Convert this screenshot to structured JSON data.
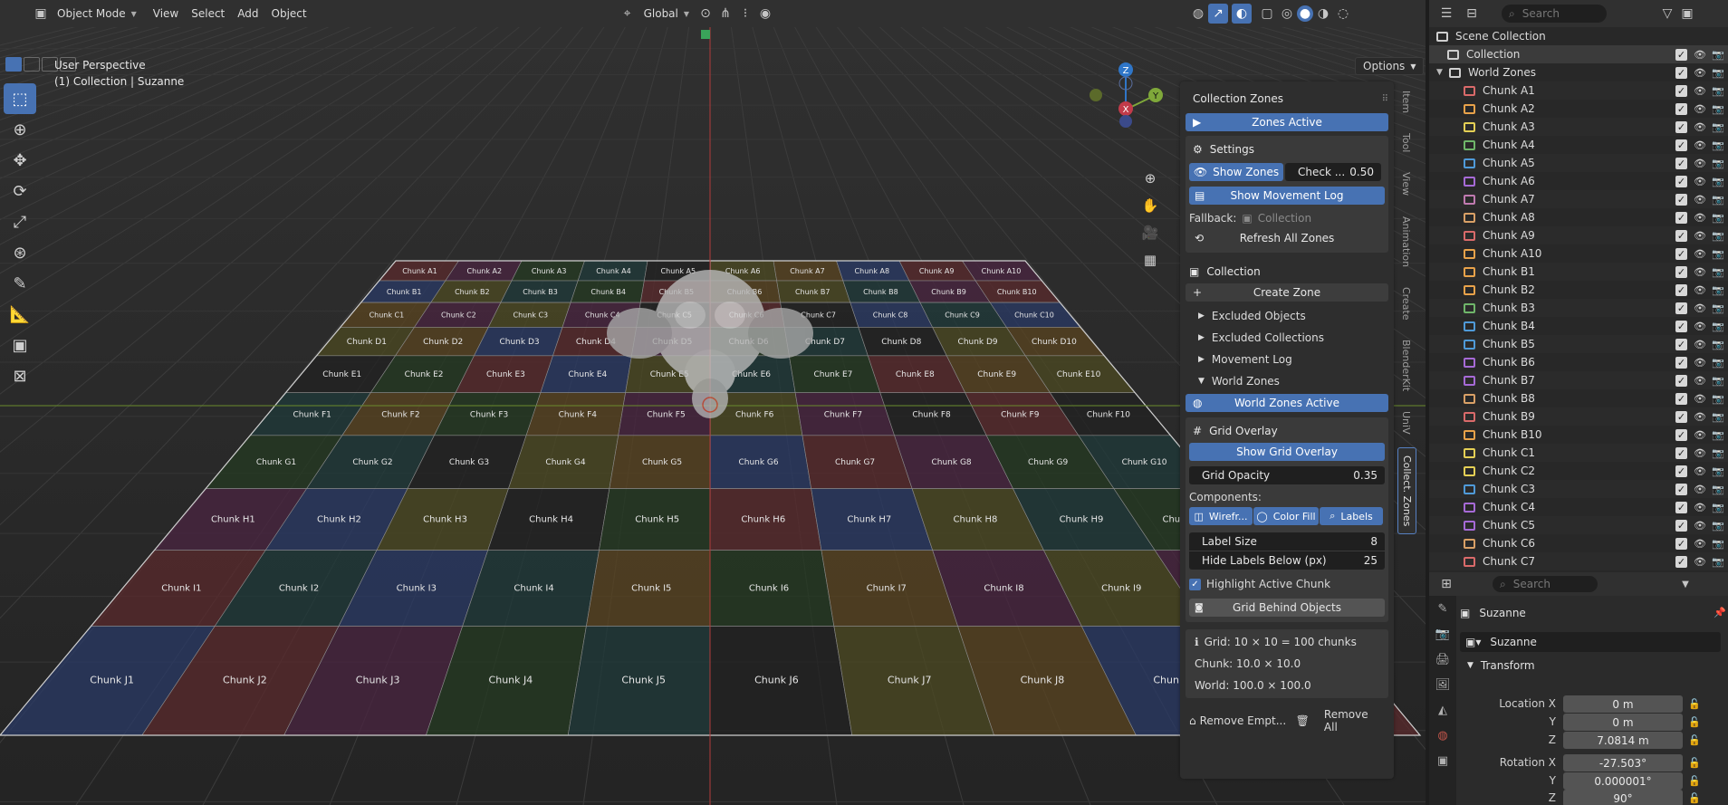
{
  "header": {
    "mode": "Object Mode",
    "menus": [
      "View",
      "Select",
      "Add",
      "Object"
    ],
    "orientation": "Global",
    "options_label": "Options"
  },
  "viewport": {
    "perspective": "User Perspective",
    "context": "(1) Collection | Suzanne",
    "gizmo": {
      "z": "Z",
      "x": "X",
      "y": "Y"
    }
  },
  "grid": {
    "rows": [
      "A",
      "B",
      "C",
      "D",
      "E",
      "F",
      "G",
      "H",
      "I",
      "J"
    ],
    "cols": 10,
    "prefix": "Chunk "
  },
  "colors": {
    "accent": "#4772b3",
    "chunk_palette": [
      "#5a2a2c",
      "#4c4a22",
      "#243a22",
      "#2a3a66",
      "#222222",
      "#4a2440",
      "#5a4420",
      "#1f3a3a"
    ]
  },
  "sidetabs": [
    "Item",
    "Tool",
    "View",
    "Animation",
    "Create",
    "BlenderKit",
    "UniV",
    "Collect. Zones"
  ],
  "panel": {
    "title": "Collection Zones",
    "zones_active": "Zones Active",
    "settings": "Settings",
    "show_zones": "Show Zones",
    "check_label": "Check ...",
    "check_value": "0.50",
    "show_movement_log": "Show Movement Log",
    "fallback_label": "Fallback:",
    "fallback_value": "Collection",
    "refresh_all": "Refresh All Zones",
    "collection_header": "Collection",
    "create_zone": "Create Zone",
    "excluded_objects": "Excluded Objects",
    "excluded_collections": "Excluded Collections",
    "movement_log": "Movement Log",
    "world_zones": "World Zones",
    "world_zones_active": "World Zones Active",
    "grid_overlay": "Grid Overlay",
    "show_grid_overlay": "Show Grid Overlay",
    "grid_opacity_label": "Grid Opacity",
    "grid_opacity_value": "0.35",
    "components_label": "Components:",
    "comp_wireframe": "Wirefr...",
    "comp_colorfill": "Color Fill",
    "comp_labels": "Labels",
    "label_size_label": "Label Size",
    "label_size_value": "8",
    "hide_labels_label": "Hide Labels Below (px)",
    "hide_labels_value": "25",
    "highlight_active": "Highlight Active Chunk",
    "grid_behind": "Grid Behind Objects",
    "info_grid": "Grid: 10 × 10 = 100 chunks",
    "info_chunk": "Chunk: 10.0 × 10.0",
    "info_world": "World: 100.0 × 100.0",
    "remove_empty": "Remove Empt...",
    "remove_all": "Remove All"
  },
  "outliner": {
    "search_placeholder": "Search",
    "scene_collection": "Scene Collection",
    "collection": "Collection",
    "world_zones": "World Zones",
    "items": [
      "Chunk A1",
      "Chunk A2",
      "Chunk A3",
      "Chunk A4",
      "Chunk A5",
      "Chunk A6",
      "Chunk A7",
      "Chunk A8",
      "Chunk A9",
      "Chunk A10",
      "Chunk B1",
      "Chunk B2",
      "Chunk B3",
      "Chunk B4",
      "Chunk B5",
      "Chunk B6",
      "Chunk B7",
      "Chunk B8",
      "Chunk B9",
      "Chunk B10",
      "Chunk C1",
      "Chunk C2",
      "Chunk C3",
      "Chunk C4",
      "Chunk C5",
      "Chunk C6",
      "Chunk C7"
    ],
    "item_colors": [
      "#d96a6a",
      "#e8a24a",
      "#e4cf55",
      "#6fb66a",
      "#4f9ad8",
      "#a66ad6",
      "#c07ab0",
      "#d9a066",
      "#d96a6a",
      "#e8a24a",
      "#e8a24a",
      "#e8a24a",
      "#6fb66a",
      "#4f9ad8",
      "#4f9ad8",
      "#a66ad6",
      "#a66ad6",
      "#d9a066",
      "#d96a6a",
      "#e8a24a",
      "#e4cf55",
      "#e4cf55",
      "#4f9ad8",
      "#a66ad6",
      "#a66ad6",
      "#d9a066",
      "#d96a6a"
    ]
  },
  "properties": {
    "search_placeholder": "Search",
    "object_name": "Suzanne",
    "object_field": "Suzanne",
    "transform": "Transform",
    "location_label": "Location X",
    "y_label": "Y",
    "z_label": "Z",
    "location": [
      "0 m",
      "0 m",
      "7.0814 m"
    ],
    "rotation_label": "Rotation X",
    "rotation": [
      "-27.503°",
      "0.000001°",
      "90°"
    ]
  }
}
